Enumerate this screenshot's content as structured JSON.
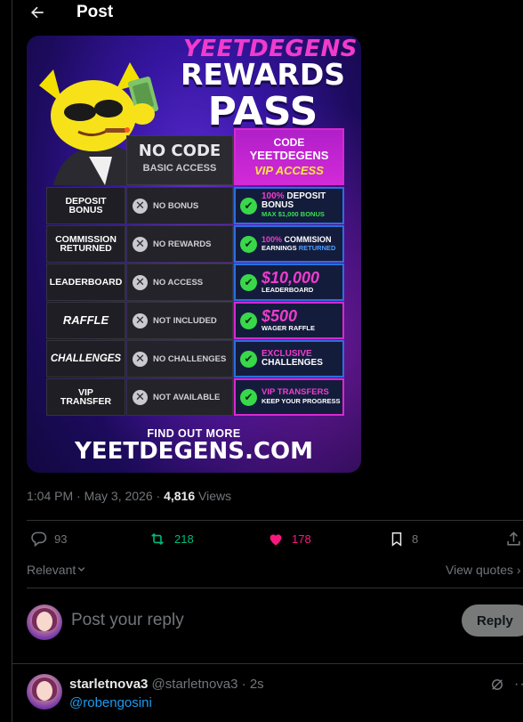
{
  "header": {
    "title": "Post"
  },
  "promo": {
    "brand": "YEETDEGENS",
    "title_line1": "REWARDS",
    "title_line2": "PASS",
    "no_code_title": "NO CODE",
    "no_code_sub": "BASIC ACCESS",
    "vip_line1": "CODE",
    "vip_line2": "YEETDEGENS",
    "vip_line3": "VIP ACCESS",
    "rows": [
      {
        "label_1": "DEPOSIT",
        "label_2": "BONUS",
        "no": "NO BONUS",
        "yes_accent": "100%",
        "yes_main": "DEPOSIT",
        "yes_main2": "BONUS",
        "yes_sub": "MAX $1,000 BONUS"
      },
      {
        "label_1": "COMMISSION",
        "label_2": "RETURNED",
        "no": "NO REWARDS",
        "yes_accent": "100%",
        "yes_main": "COMMISION",
        "yes_sub": "EARNINGS",
        "yes_sub2": "RETURNED"
      },
      {
        "label_1": "LEADERBOARD",
        "no": "NO ACCESS",
        "yes_big": "$10,000",
        "yes_sub": "LEADERBOARD"
      },
      {
        "label_1": "RAFFLE",
        "no": "NOT INCLUDED",
        "yes_big": "$500",
        "yes_sub": "WAGER RAFFLE"
      },
      {
        "label_1": "CHALLENGES",
        "no": "NO CHALLENGES",
        "yes_accent": "EXCLUSIVE",
        "yes_main": "CHALLENGES"
      },
      {
        "label_1": "VIP",
        "label_2": "TRANSFER",
        "no": "NOT AVAILABLE",
        "yes_accent": "VIP TRANSFERS",
        "yes_sub": "KEEP YOUR PROGRESS"
      }
    ],
    "find_more": "FIND OUT MORE",
    "site": "YEETDEGENS.COM"
  },
  "meta": {
    "time": "1:04 PM · May 3, 2026 · ",
    "views_count": "4,816",
    "views_label": " Views"
  },
  "actions": {
    "replies": "93",
    "reposts": "218",
    "likes": "178",
    "bookmarks": "8"
  },
  "colors": {
    "repost": "#00ba7c",
    "like": "#f91880",
    "link": "#1d9bf0"
  },
  "sort": {
    "label": "Relevant",
    "view_quotes": "View quotes"
  },
  "composer": {
    "placeholder": "Post your reply",
    "reply_button": "Reply"
  },
  "reply": {
    "name": "starletnova3",
    "handle": "@starletnova3 · 2s",
    "text": "@robengosini"
  }
}
